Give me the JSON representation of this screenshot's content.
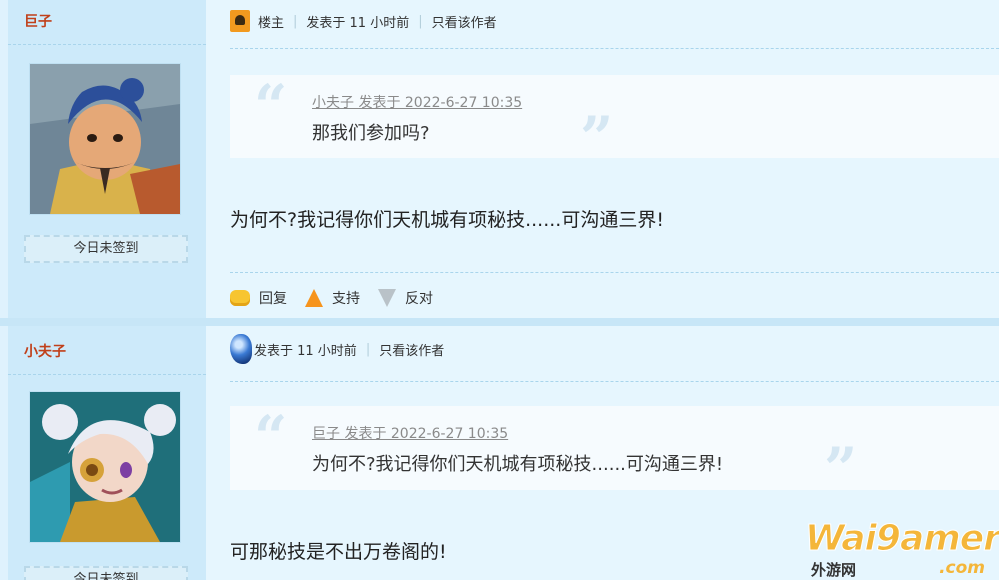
{
  "posts": [
    {
      "username": "巨子",
      "signin": "今日未签到",
      "owner_label": "楼主",
      "posted": "发表于 11 小时前",
      "only_author": "只看该作者",
      "quote": {
        "cite": "小夫子 发表于 2022-6-27 10:35",
        "text": "那我们参加吗?"
      },
      "content": "为何不?我记得你们天机城有项秘技......可沟通三界!",
      "actions": {
        "reply": "回复",
        "support": "支持",
        "oppose": "反对"
      }
    },
    {
      "username": "小夫子",
      "signin": "今日未签到",
      "posted": "发表于 11 小时前",
      "only_author": "只看该作者",
      "quote": {
        "cite": "巨子 发表于 2022-6-27 10:35",
        "text": "为何不?我记得你们天机城有项秘技......可沟通三界!"
      },
      "content": "可那秘技是不出万卷阁的!"
    }
  ],
  "icons": {
    "owner_badge": "landlord-badge-icon",
    "gem": "blue-gem-icon",
    "reply": "speech-bubble-icon",
    "support": "arrow-up-icon",
    "oppose": "arrow-down-icon"
  },
  "colors": {
    "username": "#c0401a",
    "page_bg": "#dff2fd",
    "sidebar_bg": "#cdeafa"
  },
  "watermark": {
    "brand": "Wai9amer",
    "cn": "外游网",
    "domain": ".com"
  }
}
